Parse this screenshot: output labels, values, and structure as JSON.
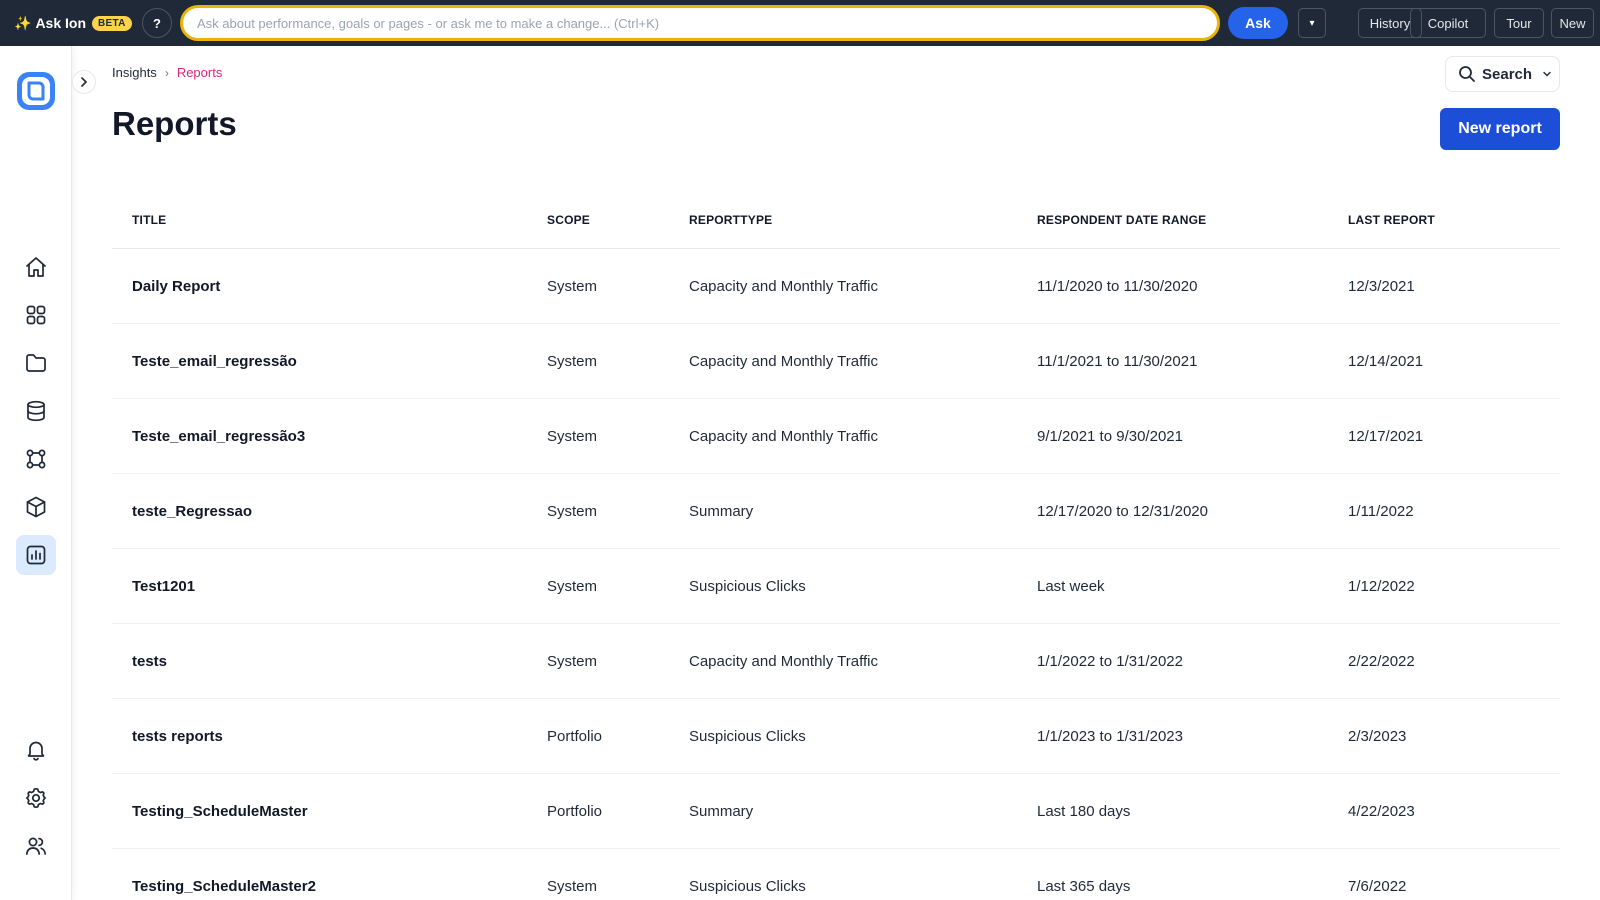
{
  "topbar": {
    "brand": "Ask Ion",
    "badge": "BETA",
    "help": "?",
    "ask_placeholder": "Ask about performance, goals or pages - or ask me to make a change... (Ctrl+K)",
    "ask_button": "Ask",
    "dropdown": "▾",
    "buttons": [
      "History",
      "Copilot",
      "Tour",
      "New"
    ]
  },
  "breadcrumb": [
    "Insights",
    "Reports"
  ],
  "page": {
    "title": "Reports",
    "search_label": "Search",
    "new_report_label": "New report"
  },
  "table": {
    "headers": [
      "TITLE",
      "SCOPE",
      "REPORTTYPE",
      "RESPONDENT DATE RANGE",
      "LAST REPORT"
    ],
    "rows": [
      [
        "Daily Report",
        "System",
        "Capacity and Monthly Traffic",
        "11/1/2020 to 11/30/2020",
        "12/3/2021"
      ],
      [
        "Teste_email_regressão",
        "System",
        "Capacity and Monthly Traffic",
        "11/1/2021 to 11/30/2021",
        "12/14/2021"
      ],
      [
        "Teste_email_regressão3",
        "System",
        "Capacity and Monthly Traffic",
        "9/1/2021 to 9/30/2021",
        "12/17/2021"
      ],
      [
        "teste_Regressao",
        "System",
        "Summary",
        "12/17/2020 to 12/31/2020",
        "1/11/2022"
      ],
      [
        "Test1201",
        "System",
        "Suspicious Clicks",
        "Last week",
        "1/12/2022"
      ],
      [
        "tests",
        "System",
        "Capacity and Monthly Traffic",
        "1/1/2022 to 1/31/2022",
        "2/22/2022"
      ],
      [
        "tests reports",
        "Portfolio",
        "Suspicious Clicks",
        "1/1/2023 to 1/31/2023",
        "2/3/2023"
      ],
      [
        "Testing_ScheduleMaster",
        "Portfolio",
        "Summary",
        "Last 180 days",
        "4/22/2023"
      ],
      [
        "Testing_ScheduleMaster2",
        "System",
        "Suspicious Clicks",
        "Last 365 days",
        "7/6/2022"
      ]
    ]
  },
  "colors": {
    "topbar_bg": "#1f2937",
    "accent_blue": "#1d4ed8",
    "ask_border": "#eab308",
    "breadcrumb_active": "#db2777"
  }
}
